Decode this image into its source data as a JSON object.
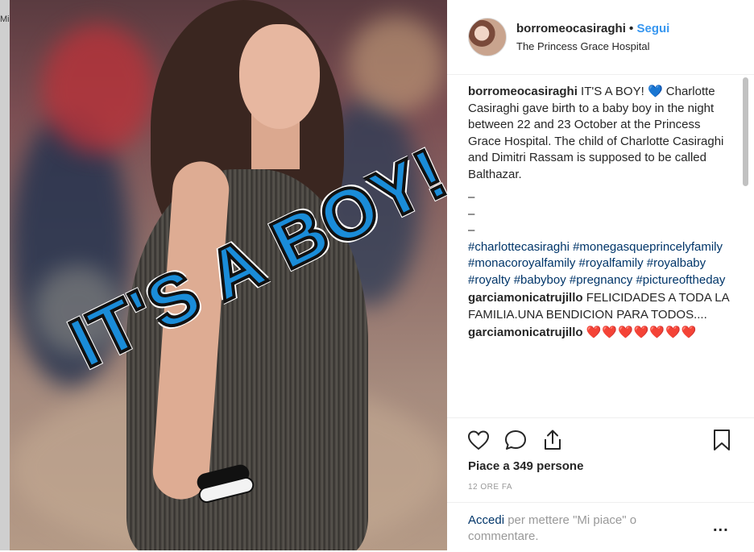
{
  "background": {
    "peek_text": "Mi"
  },
  "photo": {
    "overlay_text": "IT'S A BOY!"
  },
  "header": {
    "username": "borromeocasiraghi",
    "separator": "•",
    "follow_label": "Segui",
    "location": "The Princess Grace Hospital"
  },
  "caption": {
    "username": "borromeocasiraghi",
    "text": "IT'S A BOY! 💙 Charlotte Casiraghi gave birth to a baby boy in the night between 22 and 23 October at the Princess Grace Hospital. The child of Charlotte Casiraghi and Dimitri Rassam is supposed to be called Balthazar.",
    "dashes": [
      "–",
      "–",
      "–"
    ],
    "hashtags": "#charlottecasiraghi #monegasqueprincelyfamily #monacoroyalfamily #royalfamily #royalbaby #royalty #babyboy #pregnancy #pictureoftheday"
  },
  "comments": [
    {
      "username": "garciamonicatrujillo",
      "text": "FELICIDADES A TODA LA FAMILIA.UNA BENDICION PARA TODOS...."
    },
    {
      "username": "garciamonicatrujillo",
      "text": "❤️❤️❤️❤️❤️❤️❤️"
    }
  ],
  "actions": {
    "icons": [
      "heart-icon",
      "comment-icon",
      "share-icon",
      "bookmark-icon"
    ],
    "likes": "Piace a 349 persone",
    "time": "12 ORE FA"
  },
  "comment_box": {
    "login_link": "Accedi",
    "prompt": "per mettere \"Mi piace\" o commentare.",
    "more": "..."
  },
  "colors": {
    "link_blue": "#3897f0",
    "tag_blue": "#003569",
    "text": "#262626",
    "muted": "#999999",
    "heart_red": "#ed4956"
  }
}
